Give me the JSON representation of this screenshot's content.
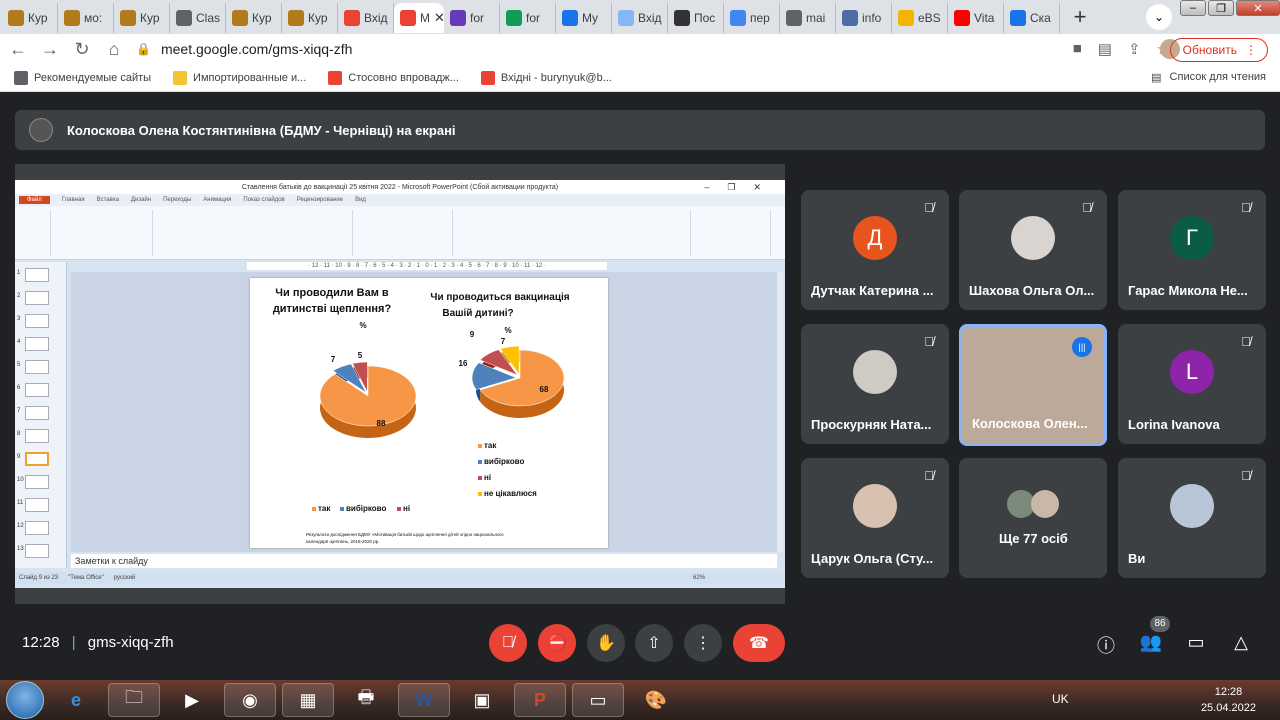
{
  "browser": {
    "tabs": [
      {
        "label": "Кур",
        "color": "#b07b1a",
        "active": false
      },
      {
        "label": "мо:",
        "color": "#b07b1a",
        "active": false
      },
      {
        "label": "Кур",
        "color": "#b07b1a",
        "active": false
      },
      {
        "label": "Clas",
        "color": "#5f6368",
        "active": false
      },
      {
        "label": "Кур",
        "color": "#b07b1a",
        "active": false
      },
      {
        "label": "Кур",
        "color": "#b07b1a",
        "active": false
      },
      {
        "label": "Вхід",
        "color": "#ea4335",
        "active": false
      },
      {
        "label": "М",
        "color": "#ea4335",
        "active": true
      },
      {
        "label": "for",
        "color": "#673ab7",
        "active": false
      },
      {
        "label": "for",
        "color": "#0f9d58",
        "active": false
      },
      {
        "label": "My",
        "color": "#1a73e8",
        "active": false
      },
      {
        "label": "Вхід",
        "color": "#8ab4f8",
        "active": false
      },
      {
        "label": "Пос",
        "color": "#333333",
        "active": false
      },
      {
        "label": "пер",
        "color": "#4285f4",
        "active": false
      },
      {
        "label": "mai",
        "color": "#5f6368",
        "active": false
      },
      {
        "label": "info",
        "color": "#4a6fa5",
        "active": false
      },
      {
        "label": "eBS",
        "color": "#f4b400",
        "active": false
      },
      {
        "label": "Vita",
        "color": "#ff0000",
        "active": false
      },
      {
        "label": "Ска",
        "color": "#1a73e8",
        "active": false
      }
    ],
    "url": "meet.google.com/gms-xiqq-zfh",
    "update_label": "Обновить",
    "bookmarks": [
      {
        "label": "Рекомендуемые сайты",
        "color": "#5f6368"
      },
      {
        "label": "Импортированные и...",
        "color": "#f4c430"
      },
      {
        "label": "Стосовно впровадж...",
        "color": "#ea4335"
      },
      {
        "label": "Вхідні - burynyuk@b...",
        "color": "#ea4335"
      }
    ],
    "reading_list": "Список для чтения"
  },
  "meet": {
    "presenter_label": "Колоскова Олена Костянтинівна (БДМУ - Чернівці) на екрані",
    "ppt": {
      "window_title": "Ставлення батьків до вакцинації 25 квітня 2022 - Microsoft PowerPoint (Сбой активации продукта)",
      "tabs": [
        "Файл",
        "Главная",
        "Вставка",
        "Дизайн",
        "Переходы",
        "Анимация",
        "Показ слайдов",
        "Рецензирование",
        "Вид"
      ],
      "ruler": "· 12 · 11 · 10 · 9 · 8 · 7 · 6 · 5 · 4 · 3 · 2 · 1 · 0 · 1 · 2 · 3 · 4 · 5 · 6 · 7 · 8 · 9 · 10 · 11 · 12 ·",
      "thumb_numbers": [
        "1",
        "2",
        "3",
        "4",
        "5",
        "6",
        "7",
        "8",
        "9",
        "10",
        "11",
        "12",
        "13"
      ],
      "notes_placeholder": "Заметки к слайду",
      "status_slide": "Слайд 9 из 23",
      "status_theme": "\"Тема Office\"",
      "status_lang": "русский",
      "status_zoom": "62%",
      "slide": {
        "q1_title": "Чи проводили Вам в дитинстві щеплення?",
        "q1_unit": "%",
        "q2_title": "Чи проводиться вакцинація Вашій дитині?",
        "q2_unit": "%",
        "legend1": [
          {
            "label": "так",
            "color": "#f79646"
          },
          {
            "label": "вибірково",
            "color": "#4f81bd"
          },
          {
            "label": "ні",
            "color": "#c0504d"
          }
        ],
        "legend2": [
          {
            "label": "так",
            "color": "#f79646"
          },
          {
            "label": "вибірково",
            "color": "#4f81bd"
          },
          {
            "label": "ні",
            "color": "#c0504d"
          },
          {
            "label": "не цікавлюся",
            "color": "#ffc000"
          }
        ],
        "footnote": "Результати дослідження БДМУ «Мотивація батьків щодо щеплення дітей згідно національного календаря щеплень, 2019-2020 рр.»"
      },
      "chart_data": [
        {
          "type": "pie",
          "title": "Чи проводили Вам в дитинстві щеплення?",
          "ylabel": "%",
          "categories": [
            "так",
            "вибірково",
            "ні"
          ],
          "values": [
            88,
            7,
            5
          ],
          "colors": [
            "#f79646",
            "#4f81bd",
            "#c0504d"
          ]
        },
        {
          "type": "pie",
          "title": "Чи проводиться вакцинація Вашій дитині?",
          "ylabel": "%",
          "categories": [
            "так",
            "вибірково",
            "ні",
            "не цікавлюся"
          ],
          "values": [
            68,
            16,
            9,
            7
          ],
          "colors": [
            "#f79646",
            "#4f81bd",
            "#c0504d",
            "#ffc000"
          ]
        }
      ]
    },
    "participants": [
      {
        "name": "Дутчак Катерина ...",
        "initial": "Д",
        "color": "#e8541e",
        "muted": true,
        "photo": false
      },
      {
        "name": "Шахова Ольга Ол...",
        "initial": "",
        "color": "#d9d4cf",
        "muted": true,
        "photo": true
      },
      {
        "name": "Гарас Микола Не...",
        "initial": "Г",
        "color": "#0b5c47",
        "muted": true,
        "photo": false
      },
      {
        "name": "Проскурняк Ната...",
        "initial": "",
        "color": "#cfcac4",
        "muted": true,
        "photo": true
      },
      {
        "name": "Колоскова Олен...",
        "initial": "",
        "color": "#bba99a",
        "muted": false,
        "photo": true,
        "speaking": true
      },
      {
        "name": "Lorina Ivanova",
        "initial": "L",
        "color": "#8e24aa",
        "muted": true,
        "photo": false
      },
      {
        "name": "Царук Ольга (Сту...",
        "initial": "",
        "color": "#d8c1b0",
        "muted": true,
        "photo": true
      },
      {
        "name": "Ще 77 осіб",
        "initial": "",
        "color": "#5f6368",
        "muted": false,
        "photo": true
      },
      {
        "name": "Ви",
        "initial": "",
        "color": "#b9c6d8",
        "muted": true,
        "photo": true
      }
    ],
    "time": "12:28",
    "meeting_code": "gms-xiqq-zfh",
    "participant_count": "86"
  },
  "taskbar": {
    "lang": "UK",
    "clock_time": "12:28",
    "clock_date": "25.04.2022"
  }
}
